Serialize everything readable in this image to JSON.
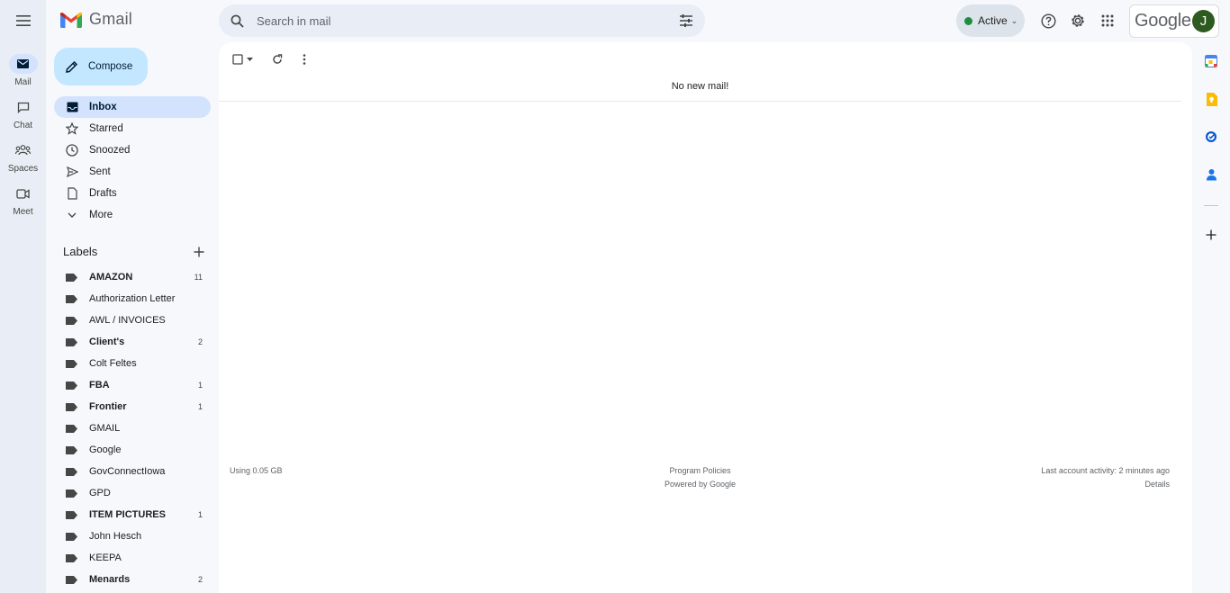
{
  "app": {
    "name": "Gmail",
    "google_wordmark": "Google",
    "avatar_initial": "J"
  },
  "rail": [
    {
      "label": "Mail",
      "icon": "mail-icon",
      "active": true
    },
    {
      "label": "Chat",
      "icon": "chat-icon"
    },
    {
      "label": "Spaces",
      "icon": "spaces-icon"
    },
    {
      "label": "Meet",
      "icon": "meet-icon"
    }
  ],
  "search": {
    "placeholder": "Search in mail",
    "value": ""
  },
  "status": {
    "label": "Active",
    "color": "#1e8e3e"
  },
  "compose": {
    "label": "Compose"
  },
  "nav": [
    {
      "label": "Inbox",
      "icon": "inbox-icon",
      "active": true
    },
    {
      "label": "Starred",
      "icon": "star-icon"
    },
    {
      "label": "Snoozed",
      "icon": "clock-icon"
    },
    {
      "label": "Sent",
      "icon": "send-icon"
    },
    {
      "label": "Drafts",
      "icon": "draft-icon"
    },
    {
      "label": "More",
      "icon": "chevron-down-icon"
    }
  ],
  "labels_section": {
    "title": "Labels"
  },
  "labels": [
    {
      "name": "AMAZON",
      "count": "11",
      "bold": true
    },
    {
      "name": "Authorization Letter",
      "count": "",
      "bold": false
    },
    {
      "name": "AWL / INVOICES",
      "count": "",
      "bold": false
    },
    {
      "name": "Client's",
      "count": "2",
      "bold": true
    },
    {
      "name": "Colt Feltes",
      "count": "",
      "bold": false
    },
    {
      "name": "FBA",
      "count": "1",
      "bold": true
    },
    {
      "name": "Frontier",
      "count": "1",
      "bold": true
    },
    {
      "name": "GMAIL",
      "count": "",
      "bold": false
    },
    {
      "name": "Google",
      "count": "",
      "bold": false
    },
    {
      "name": "GovConnectIowa",
      "count": "",
      "bold": false
    },
    {
      "name": "GPD",
      "count": "",
      "bold": false
    },
    {
      "name": "ITEM PICTURES",
      "count": "1",
      "bold": true
    },
    {
      "name": "John Hesch",
      "count": "",
      "bold": false
    },
    {
      "name": "KEEPA",
      "count": "",
      "bold": false
    },
    {
      "name": "Menards",
      "count": "2",
      "bold": true
    }
  ],
  "main": {
    "empty_message": "No new mail!",
    "storage": "Using 0.05 GB",
    "program_policies": "Program Policies",
    "powered_by": "Powered by Google",
    "last_activity": "Last account activity: 2 minutes ago",
    "details": "Details"
  },
  "side_panel": [
    "calendar-icon",
    "keep-icon",
    "tasks-icon",
    "contacts-icon",
    "add-icon"
  ],
  "colors": {
    "accent": "#0b57d0",
    "compose_bg": "#c2e7ff",
    "selected_bg": "#d3e3fd",
    "page_bg": "#f6f8fc"
  }
}
